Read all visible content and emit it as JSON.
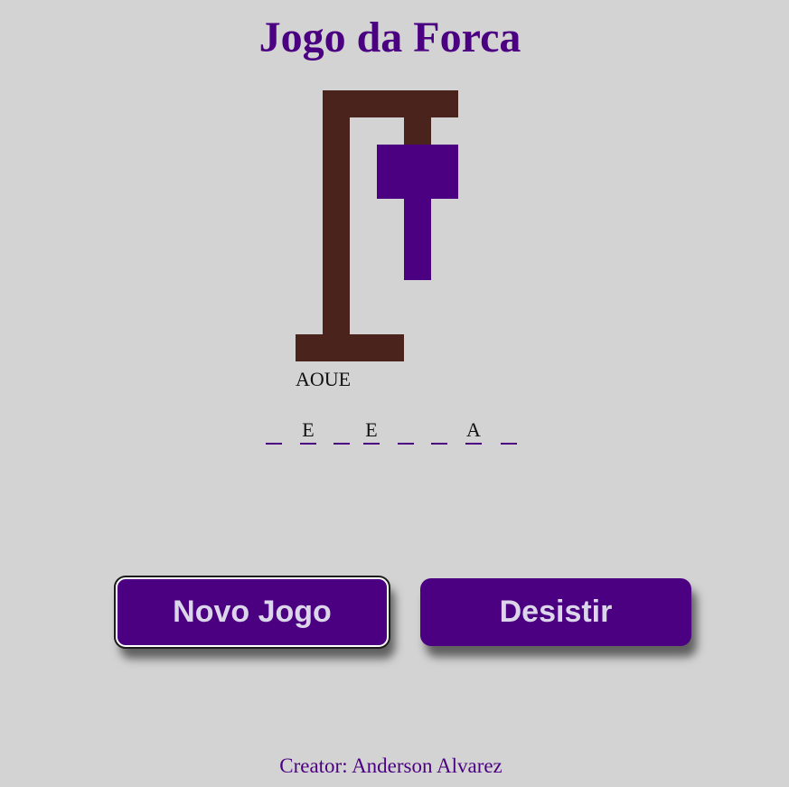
{
  "title": "Jogo da Forca",
  "used_letters": "AOUE",
  "word_slots": [
    "",
    "E",
    "",
    "E",
    "",
    "",
    "A",
    ""
  ],
  "buttons": {
    "new_game": "Novo Jogo",
    "give_up": "Desistir"
  },
  "footer": "Creator: Anderson Alvarez",
  "colors": {
    "background": "#d3d3d3",
    "accent": "#4b0082",
    "gallows": "#4a231c",
    "button_text": "#dcd6ea"
  }
}
